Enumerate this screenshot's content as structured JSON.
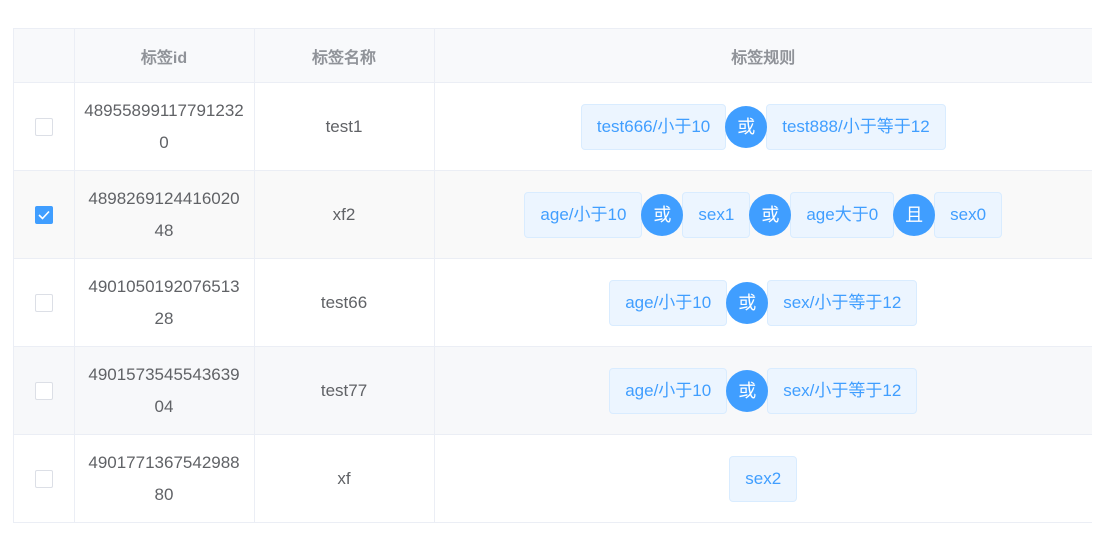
{
  "table": {
    "headers": {
      "id": "标签id",
      "name": "标签名称",
      "rule": "标签规则"
    },
    "rows": [
      {
        "checked": false,
        "id": "489558991177912320",
        "name": "test1",
        "rules": [
          {
            "kind": "tag",
            "text": "test666/小于10"
          },
          {
            "kind": "op",
            "text": "或"
          },
          {
            "kind": "tag",
            "text": "test888/小于等于12"
          }
        ]
      },
      {
        "checked": true,
        "id": "489826912441602048",
        "name": "xf2",
        "rules": [
          {
            "kind": "tag",
            "text": "age/小于10"
          },
          {
            "kind": "op",
            "text": "或"
          },
          {
            "kind": "tag",
            "text": "sex1"
          },
          {
            "kind": "op",
            "text": "或"
          },
          {
            "kind": "tag",
            "text": "age大于0"
          },
          {
            "kind": "op",
            "text": "且"
          },
          {
            "kind": "tag",
            "text": "sex0"
          }
        ]
      },
      {
        "checked": false,
        "id": "490105019207651328",
        "name": "test66",
        "rules": [
          {
            "kind": "tag",
            "text": "age/小于10"
          },
          {
            "kind": "op",
            "text": "或"
          },
          {
            "kind": "tag",
            "text": "sex/小于等于12"
          }
        ]
      },
      {
        "checked": false,
        "id": "490157354554363904",
        "name": "test77",
        "rules": [
          {
            "kind": "tag",
            "text": "age/小于10"
          },
          {
            "kind": "op",
            "text": "或"
          },
          {
            "kind": "tag",
            "text": "sex/小于等于12"
          }
        ]
      },
      {
        "checked": false,
        "id": "490177136754298880",
        "name": "xf",
        "rules": [
          {
            "kind": "tag",
            "text": "sex2"
          }
        ]
      }
    ]
  },
  "colors": {
    "primary": "#409eff",
    "tag_bg": "#ecf5ff",
    "header_text": "#909399",
    "body_text": "#606266"
  },
  "icons": {
    "check": "check-icon"
  }
}
